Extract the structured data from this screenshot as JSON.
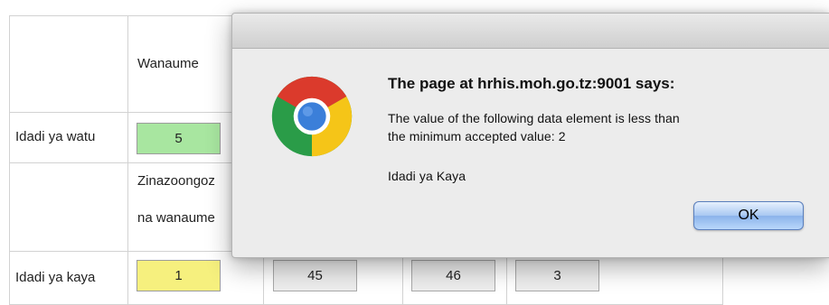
{
  "table": {
    "header_col1": "Wanaume",
    "row1_label": "Idadi ya watu",
    "row1_values": [
      "5"
    ],
    "subheader_line1": "Zinazoongoz",
    "subheader_line2": "na wanaume",
    "row2_label": "Idadi ya kaya",
    "row2_values": [
      "1",
      "45",
      "46",
      "3"
    ]
  },
  "dialog": {
    "heading": "The page at hrhis.moh.go.tz:9001 says:",
    "message_line1": "The value of the following data element is less than",
    "message_line2": "the minimum accepted value: 2",
    "element_name": "Idadi ya Kaya",
    "ok_label": "OK",
    "icon": "chrome-logo-icon"
  },
  "colors": {
    "below_min_highlight": "#f6f07e",
    "valid_highlight": "#a8e6a0",
    "ok_button": "#a9c8f2"
  }
}
